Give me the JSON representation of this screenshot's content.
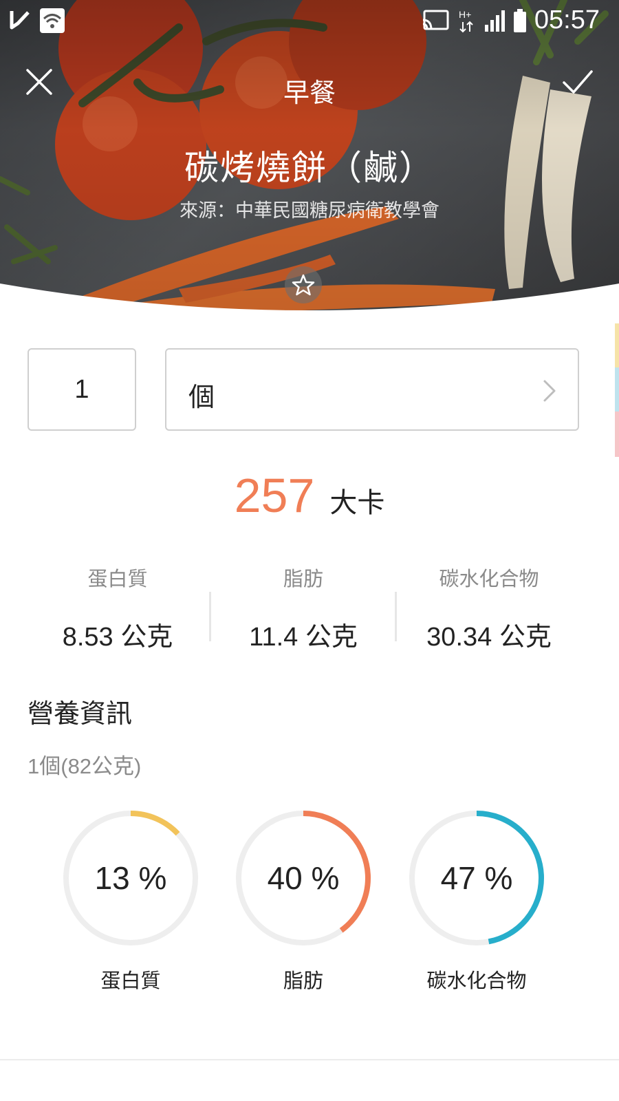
{
  "status_bar": {
    "time": "05:57",
    "icons": [
      "check-notification-icon",
      "wifi-icon",
      "cast-icon",
      "h-plus-network-icon",
      "signal-icon",
      "battery-icon"
    ]
  },
  "header": {
    "meal": "早餐",
    "food_name": "碳烤燒餅（鹹）",
    "source": "來源：中華民國糖尿病衛教學會",
    "close_icon": "close-icon",
    "confirm_icon": "check-icon",
    "favorite_icon": "star-outline-icon"
  },
  "serving": {
    "quantity": "1",
    "unit": "個"
  },
  "calories": {
    "value": "257",
    "unit": "大卡",
    "color": "#f07e56"
  },
  "macros": [
    {
      "label": "蛋白質",
      "value": "8.53 公克"
    },
    {
      "label": "脂肪",
      "value": "11.4 公克"
    },
    {
      "label": "碳水化合物",
      "value": "30.34 公克"
    }
  ],
  "nutrition": {
    "title": "營養資訊",
    "serving_note": "1個(82公克)",
    "ratios": [
      {
        "label": "蛋白質",
        "percent_text": "13 %",
        "fraction": 0.13,
        "color": "#f2c35a"
      },
      {
        "label": "脂肪",
        "percent_text": "40 %",
        "fraction": 0.4,
        "color": "#f07e56"
      },
      {
        "label": "碳水化合物",
        "percent_text": "47 %",
        "fraction": 0.47,
        "color": "#27aecb"
      }
    ]
  },
  "colors": {
    "ring_track": "#eeeeee",
    "side_indicators": [
      "#f6e3a8",
      "#bfe3ee",
      "#f6c6c8"
    ]
  }
}
